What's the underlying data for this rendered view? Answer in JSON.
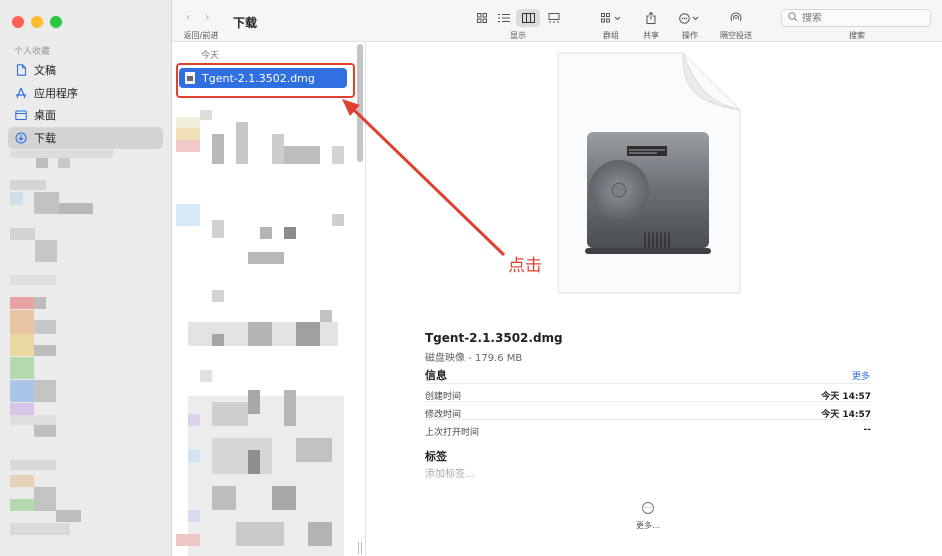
{
  "window": {
    "title": "下载",
    "traffic_lights": {
      "close": "#ff5f57",
      "minimize": "#febc2e",
      "zoom": "#28c840"
    }
  },
  "toolbar": {
    "back_label": "‹",
    "forward_label": "›",
    "back_forward_caption": "返回/前进",
    "view_caption": "显示",
    "group_caption": "群组",
    "share_caption": "共享",
    "action_caption": "操作",
    "airdrop_caption": "隔空投送",
    "search_caption": "搜索",
    "search_placeholder": "搜索"
  },
  "sidebar": {
    "section_title": "个人收藏",
    "items": [
      {
        "label": "文稿",
        "icon": "document-icon"
      },
      {
        "label": "应用程序",
        "icon": "applications-icon"
      },
      {
        "label": "桌面",
        "icon": "desktop-icon"
      },
      {
        "label": "下载",
        "icon": "download-icon",
        "active": true
      }
    ]
  },
  "column": {
    "header": "今天",
    "selected_file": "Tgent-2.1.3502.dmg"
  },
  "preview": {
    "name": "Tgent-2.1.3502.dmg",
    "kind": "磁盘映像 - 179.6 MB",
    "info_title": "信息",
    "more_label": "更多",
    "rows": [
      {
        "label": "创建时间",
        "value": "今天 14:57"
      },
      {
        "label": "修改时间",
        "value": "今天 14:57"
      },
      {
        "label": "上次打开时间",
        "value": "--"
      }
    ],
    "tags_title": "标签",
    "tags_placeholder": "添加标签…",
    "more_button_label": "更多…"
  },
  "annotation": {
    "text": "点击",
    "color": "#e0402d"
  },
  "colors": {
    "accent": "#2f6fe0"
  }
}
